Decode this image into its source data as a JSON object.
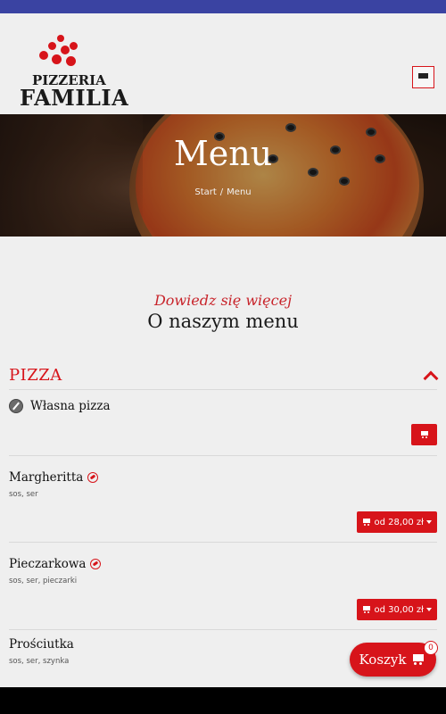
{
  "colors": {
    "accent": "#d7141a",
    "topbar": "#3a43a2",
    "background": "#efefef"
  },
  "brand": {
    "logo_line1": "PIZZERIA",
    "logo_line2": "FAMILIA"
  },
  "hero": {
    "title": "Menu",
    "breadcrumb": [
      "Start",
      "/",
      "Menu"
    ]
  },
  "intro": {
    "subtitle": "Dowiedz się więcej",
    "title": "O naszym menu"
  },
  "category": {
    "title": "PIZZA",
    "items": [
      {
        "name": "Własna pizza",
        "description": "",
        "icon": "edit-pencil-icon"
      },
      {
        "name": "Margheritta",
        "description": "sos, ser",
        "price_label": "od 28,00 zł"
      },
      {
        "name": "Pieczarkowa",
        "description": "sos, ser, pieczarki",
        "price_label": "od 30,00 zł"
      },
      {
        "name": "Prościutka",
        "description": "sos, ser, szynka"
      }
    ]
  },
  "cart": {
    "label": "Koszyk",
    "count": "0"
  }
}
